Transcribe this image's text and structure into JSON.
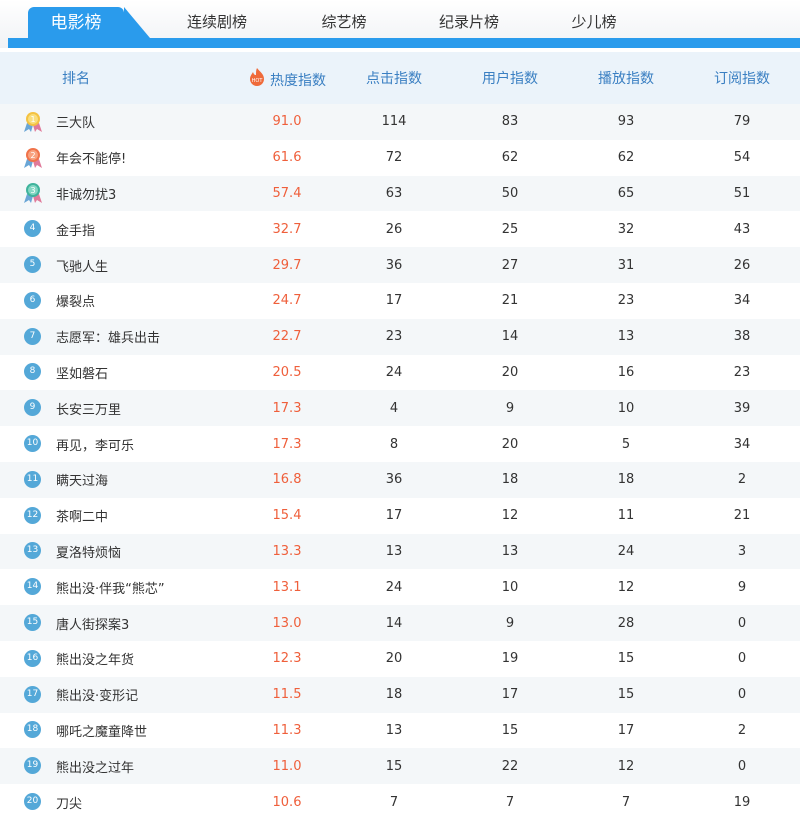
{
  "tabs": [
    {
      "label": "电影榜",
      "active": true
    },
    {
      "label": "连续剧榜",
      "active": false
    },
    {
      "label": "综艺榜",
      "active": false
    },
    {
      "label": "纪录片榜",
      "active": false
    },
    {
      "label": "少儿榜",
      "active": false
    }
  ],
  "columns": {
    "rank": "排名",
    "heat": "热度指数",
    "click": "点击指数",
    "user": "用户指数",
    "play": "播放指数",
    "subscribe": "订阅指数",
    "hot_badge": "HOT"
  },
  "colors": {
    "accent": "#2a9bec",
    "heat_value": "#ef5f3b",
    "header_text": "#3a7fc2",
    "rank_circle": "#54a8d8"
  },
  "rows": [
    {
      "rank": "1",
      "name": "三大队",
      "heat": "91.0",
      "click": "114",
      "user": "83",
      "play": "93",
      "subscribe": "79",
      "medal": "gold"
    },
    {
      "rank": "2",
      "name": "年会不能停!",
      "heat": "61.6",
      "click": "72",
      "user": "62",
      "play": "62",
      "subscribe": "54",
      "medal": "orange"
    },
    {
      "rank": "3",
      "name": "非诚勿扰3",
      "heat": "57.4",
      "click": "63",
      "user": "50",
      "play": "65",
      "subscribe": "51",
      "medal": "teal"
    },
    {
      "rank": "4",
      "name": "金手指",
      "heat": "32.7",
      "click": "26",
      "user": "25",
      "play": "32",
      "subscribe": "43"
    },
    {
      "rank": "5",
      "name": "飞驰人生",
      "heat": "29.7",
      "click": "36",
      "user": "27",
      "play": "31",
      "subscribe": "26"
    },
    {
      "rank": "6",
      "name": "爆裂点",
      "heat": "24.7",
      "click": "17",
      "user": "21",
      "play": "23",
      "subscribe": "34"
    },
    {
      "rank": "7",
      "name": "志愿军：雄兵出击",
      "heat": "22.7",
      "click": "23",
      "user": "14",
      "play": "13",
      "subscribe": "38"
    },
    {
      "rank": "8",
      "name": "坚如磐石",
      "heat": "20.5",
      "click": "24",
      "user": "20",
      "play": "16",
      "subscribe": "23"
    },
    {
      "rank": "9",
      "name": "长安三万里",
      "heat": "17.3",
      "click": "4",
      "user": "9",
      "play": "10",
      "subscribe": "39"
    },
    {
      "rank": "10",
      "name": "再见，李可乐",
      "heat": "17.3",
      "click": "8",
      "user": "20",
      "play": "5",
      "subscribe": "34"
    },
    {
      "rank": "11",
      "name": "瞒天过海",
      "heat": "16.8",
      "click": "36",
      "user": "18",
      "play": "18",
      "subscribe": "2"
    },
    {
      "rank": "12",
      "name": "茶啊二中",
      "heat": "15.4",
      "click": "17",
      "user": "12",
      "play": "11",
      "subscribe": "21"
    },
    {
      "rank": "13",
      "name": "夏洛特烦恼",
      "heat": "13.3",
      "click": "13",
      "user": "13",
      "play": "24",
      "subscribe": "3"
    },
    {
      "rank": "14",
      "name": "熊出没·伴我“熊芯”",
      "heat": "13.1",
      "click": "24",
      "user": "10",
      "play": "12",
      "subscribe": "9"
    },
    {
      "rank": "15",
      "name": "唐人街探案3",
      "heat": "13.0",
      "click": "14",
      "user": "9",
      "play": "28",
      "subscribe": "0"
    },
    {
      "rank": "16",
      "name": "熊出没之年货",
      "heat": "12.3",
      "click": "20",
      "user": "19",
      "play": "15",
      "subscribe": "0"
    },
    {
      "rank": "17",
      "name": "熊出没·变形记",
      "heat": "11.5",
      "click": "18",
      "user": "17",
      "play": "15",
      "subscribe": "0"
    },
    {
      "rank": "18",
      "name": "哪吒之魔童降世",
      "heat": "11.3",
      "click": "13",
      "user": "15",
      "play": "17",
      "subscribe": "2"
    },
    {
      "rank": "19",
      "name": "熊出没之过年",
      "heat": "11.0",
      "click": "15",
      "user": "22",
      "play": "12",
      "subscribe": "0"
    },
    {
      "rank": "20",
      "name": "刀尖",
      "heat": "10.6",
      "click": "7",
      "user": "7",
      "play": "7",
      "subscribe": "19"
    }
  ]
}
